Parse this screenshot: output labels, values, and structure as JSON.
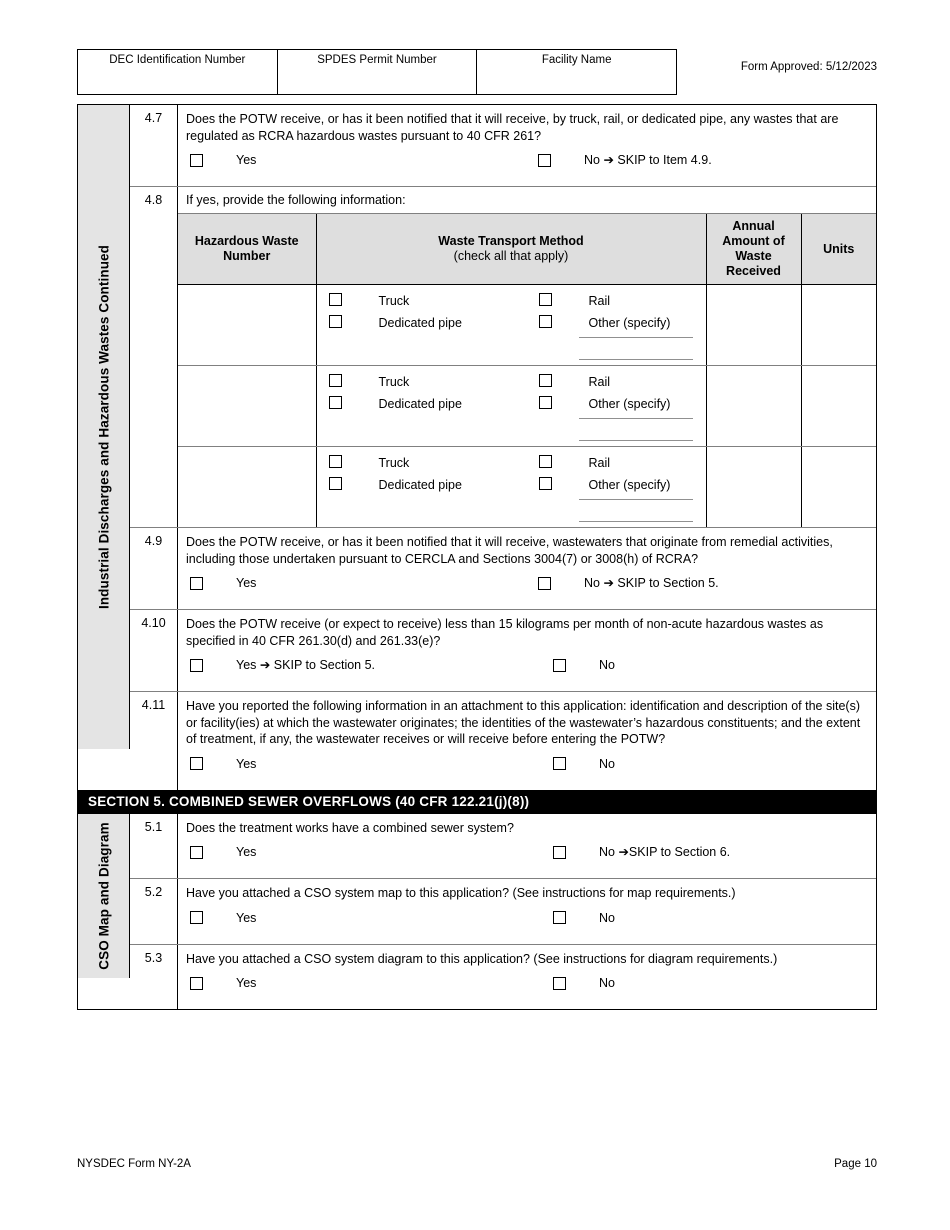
{
  "header": {
    "columns": [
      "DEC Identification Number",
      "SPDES Permit Number",
      "Facility Name"
    ],
    "form_approved": "Form Approved: 5/12/2023"
  },
  "section4": {
    "side_label": "Industrial Discharges and Hazardous Wastes Continued",
    "q47": {
      "number": "4.7",
      "text": "Does the POTW receive, or has it been notified that it will receive, by truck, rail, or dedicated pipe, any wastes that are regulated as RCRA hazardous wastes pursuant to 40 CFR 261?",
      "yes": "Yes",
      "no": "No ➔ SKIP to Item 4.9."
    },
    "q48": {
      "number": "4.8",
      "intro": "If yes, provide the following information:",
      "columns": {
        "hazardous_waste_number": "Hazardous Waste Number",
        "waste_transport_method": "Waste Transport Method",
        "waste_transport_method_sub": "(check all that apply)",
        "annual_amount": "Annual Amount of Waste Received",
        "units": "Units"
      },
      "methods": [
        "Truck",
        "Rail",
        "Dedicated pipe",
        "Other (specify)"
      ],
      "row_count": 3
    },
    "q49": {
      "number": "4.9",
      "text": "Does the POTW receive, or has it been notified that it will receive, wastewaters that originate from remedial activities, including those undertaken pursuant to CERCLA and Sections 3004(7) or 3008(h) of RCRA?",
      "yes": "Yes",
      "no": "No ➔ SKIP to Section 5."
    },
    "q410": {
      "number": "4.10",
      "text": "Does the POTW receive (or expect to receive) less than 15 kilograms per month of non-acute hazardous wastes as specified in 40 CFR 261.30(d) and 261.33(e)?",
      "yes": "Yes ➔ SKIP to Section 5.",
      "no": "No"
    },
    "q411": {
      "number": "4.11",
      "text": "Have you reported the following information in an attachment to this application: identification and description of the site(s) or facility(ies) at which the wastewater originates; the identities of the wastewater’s hazardous constituents; and the extent of treatment, if any, the wastewater receives or will receive before entering the POTW?",
      "yes": "Yes",
      "no": "No"
    }
  },
  "section5": {
    "bar_title": "SECTION 5. COMBINED SEWER OVERFLOWS  (40 CFR 122.21(j)(8))",
    "side_label": "CSO Map and Diagram",
    "q51": {
      "number": "5.1",
      "text": "Does the treatment works have a combined sewer system?",
      "yes": "Yes",
      "no": "No ➔SKIP to Section 6."
    },
    "q52": {
      "number": "5.2",
      "text": "Have you attached a CSO system map to this application? (See instructions for map requirements.)",
      "yes": "Yes",
      "no": "No"
    },
    "q53": {
      "number": "5.3",
      "text": "Have you attached a CSO system diagram to this application? (See instructions for diagram requirements.)",
      "yes": "Yes",
      "no": "No"
    }
  },
  "footer": {
    "form_name": "NYSDEC Form NY-2A",
    "page": "Page 10"
  }
}
